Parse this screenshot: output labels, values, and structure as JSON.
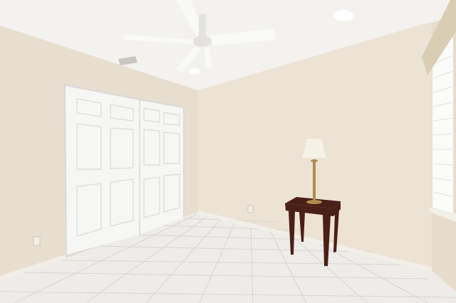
{
  "scene": {
    "kind": "interior-photo",
    "palette": {
      "ceiling": "#f4f2ee",
      "left_wall": "#e8decf",
      "back_wall": "#ece3d4",
      "right_wall": "#e6dccb",
      "floor": "#eeece8",
      "grout": "#d8d5cf",
      "door": "#f6f6f4",
      "door_shadow": "#dcdad6",
      "baseboard": "#f2efe9",
      "table_wood": "#4a1f17",
      "lamp_shade": "#f5f1e6",
      "lamp_brass": "#b08c4e",
      "window_light": "#fbfbf9",
      "valance": "#d9cdb4"
    },
    "icons": [
      "ceiling-fan-icon",
      "recessed-light-icon",
      "air-vent-icon",
      "table-lamp-icon",
      "side-table-icon",
      "electrical-outlet-icon"
    ]
  }
}
